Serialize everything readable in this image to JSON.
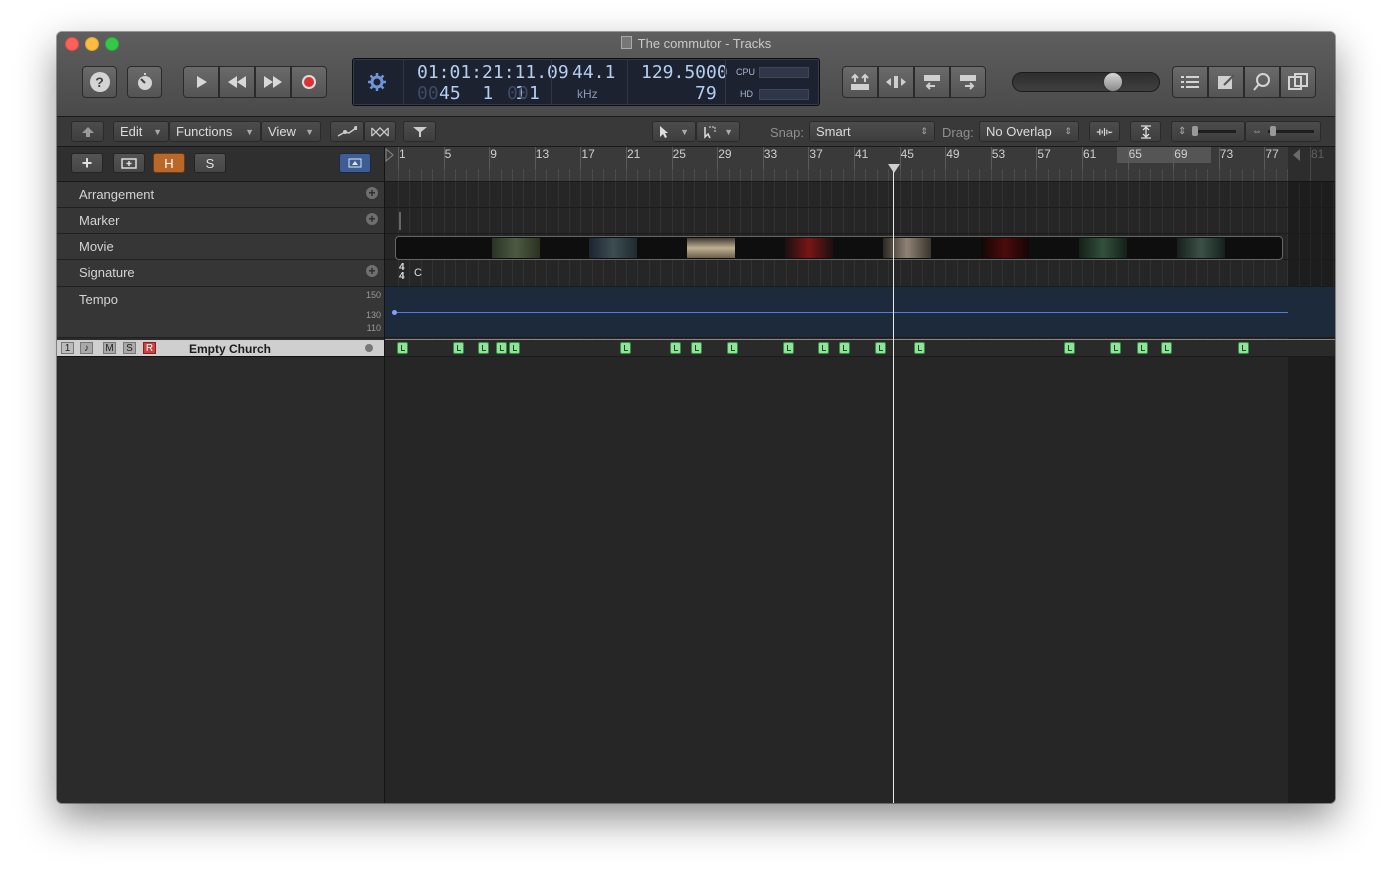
{
  "window": {
    "title": "The commutor - Tracks"
  },
  "control_bar": {
    "lcd": {
      "position_time": "01:01:21:11.09",
      "position_bars_dim": "00",
      "position_bars": "45  1  1",
      "position_ticks_dim": "00",
      "position_ticks": "1",
      "sample_rate": "44.1",
      "sample_rate_unit": "kHz",
      "tempo": "129.5000",
      "tempo_sub": "79",
      "cpu_label": "CPU",
      "hd_label": "HD"
    },
    "master_volume_level": 0.62
  },
  "toolbar": {
    "edit": "Edit",
    "functions": "Functions",
    "view": "View",
    "snap_label": "Snap:",
    "snap_value": "Smart",
    "drag_label": "Drag:",
    "drag_value": "No Overlap"
  },
  "track_header": {
    "add_label": "+",
    "h_label": "H",
    "s_label": "S"
  },
  "global_tracks": [
    {
      "name": "Arrangement"
    },
    {
      "name": "Marker"
    },
    {
      "name": "Movie"
    },
    {
      "name": "Signature"
    },
    {
      "name": "Tempo",
      "ticks": [
        "150",
        "130",
        "110"
      ]
    }
  ],
  "signature": {
    "top": "4",
    "bottom": "4",
    "key": "C"
  },
  "track": {
    "number": "1",
    "m": "M",
    "s": "S",
    "r": "R",
    "name": "Empty Church"
  },
  "ruler_numbers": [
    "1",
    "5",
    "9",
    "13",
    "17",
    "21",
    "25",
    "29",
    "33",
    "37",
    "41",
    "45",
    "49",
    "53",
    "57",
    "61",
    "65",
    "69",
    "73",
    "77",
    "81"
  ],
  "colors": {
    "region": "#8fe39b",
    "record": "#c94141",
    "h_button": "#c8762b",
    "tempo_line": "#4d7de0"
  }
}
